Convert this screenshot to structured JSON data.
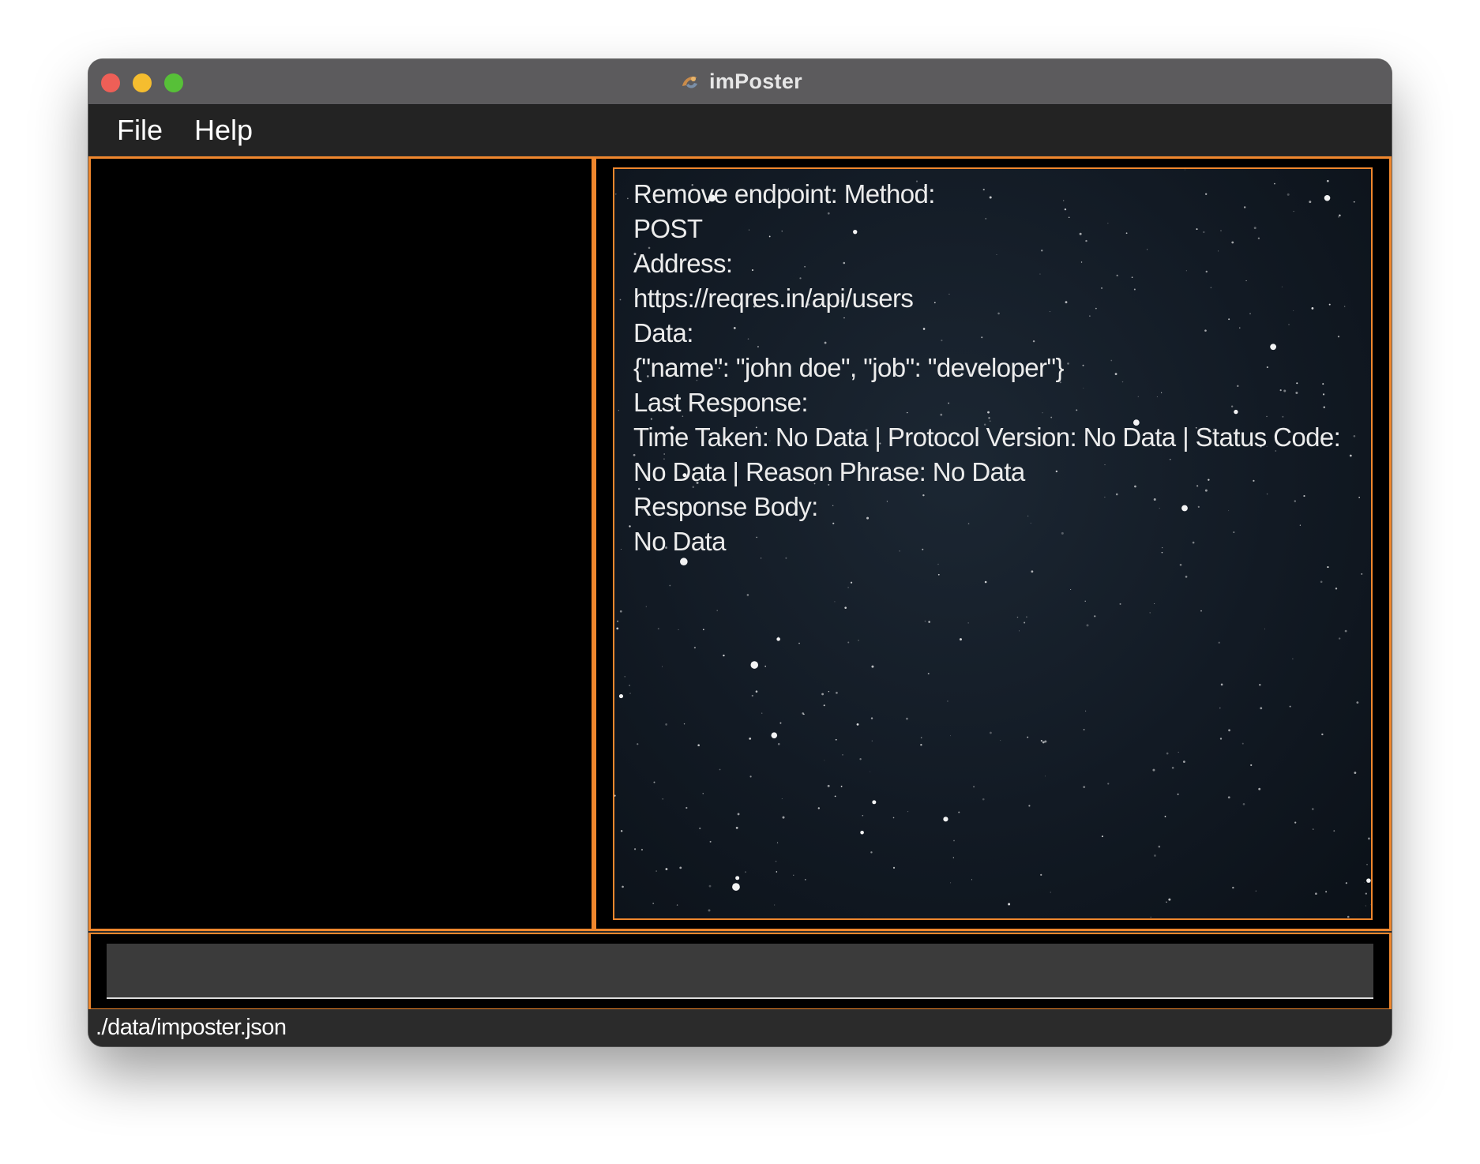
{
  "window": {
    "title": "imPoster",
    "app_icon": "imposter-app-icon",
    "accent_color": "#f0872d"
  },
  "menubar": {
    "items": [
      {
        "label": "File"
      },
      {
        "label": "Help"
      }
    ]
  },
  "endpoint_list": {
    "items": []
  },
  "endpoint_detail": {
    "lines": [
      "Remove endpoint: Method:",
      "POST",
      "Address:",
      "https://reqres.in/api/users",
      "Data:",
      "{\"name\": \"john doe\", \"job\": \"developer\"}",
      "Last Response:",
      "Time Taken: No Data | Protocol Version: No Data | Status Code:",
      "No Data | Reason Phrase: No Data",
      "Response Body:",
      "No Data"
    ],
    "background": "starfield"
  },
  "command_box": {
    "value": "",
    "placeholder": ""
  },
  "status_bar": {
    "file_path": "./data/imposter.json"
  }
}
